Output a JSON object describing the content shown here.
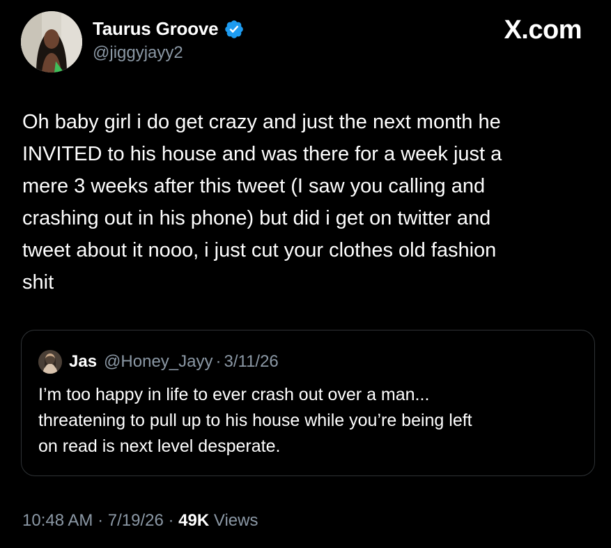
{
  "author": {
    "display_name": "Taurus Groove",
    "handle": "@jiggyjayy2",
    "verified_icon": "verified-badge-icon",
    "verified_color": "#1d9bf0"
  },
  "brand": {
    "label": "X.com"
  },
  "tweet": {
    "text": "Oh baby girl i do get crazy and just the next month he\nINVITED to his house and was there for a week just a\nmere 3 weeks after this tweet (I saw you calling and\ncrashing out in his phone) but did i get on twitter and\ntweet about it nooo, i just cut your clothes old fashion\nshit"
  },
  "quote": {
    "name": "Jas",
    "handle": "@Honey_Jayy",
    "separator": "·",
    "date": "3/11/26",
    "text": "I’m too happy in life to ever crash out over a man...\nthreatening to pull up to his house while you’re being left\non read is next level desperate."
  },
  "footer": {
    "time": "10:48 AM",
    "sep1": "·",
    "date": "7/19/26",
    "sep2": "·",
    "views_count": "49K",
    "views_label": "Views"
  },
  "colors": {
    "background": "#000000",
    "text_primary": "#ffffff",
    "text_secondary": "#8b98a5",
    "border": "#2f3336"
  }
}
